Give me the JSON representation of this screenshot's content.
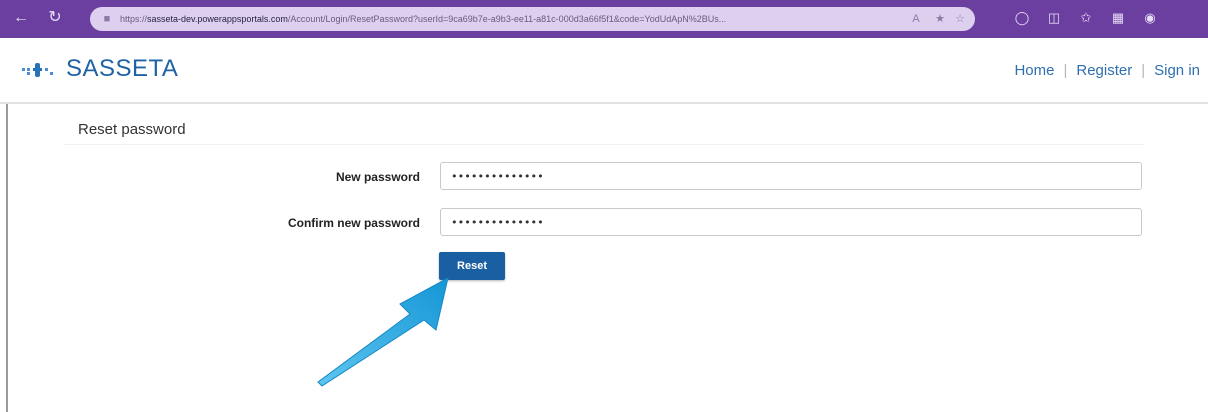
{
  "browser": {
    "url_scheme": "https://",
    "url_host": "sasseta-dev.powerappsportals.com",
    "url_path": "/Account/Login/ResetPassword?userId=9ca69b7e-a9b3-ee11-a81c-000d3a66f5f1&code=YodUdApN%2BUs..."
  },
  "header": {
    "brand": "SASSETA",
    "nav": {
      "home": "Home",
      "register": "Register",
      "sign_in": "Sign in"
    }
  },
  "page": {
    "title": "Reset password"
  },
  "form": {
    "new_password_label": "New password",
    "new_password_value": "••••••••••••••",
    "confirm_password_label": "Confirm new password",
    "confirm_password_value": "••••••••••••••",
    "reset_button": "Reset"
  },
  "colors": {
    "browser_bar": "#6b3fa0",
    "brand": "#1f63a6",
    "button": "#1b5fa3",
    "arrow": "#29a8e0"
  }
}
